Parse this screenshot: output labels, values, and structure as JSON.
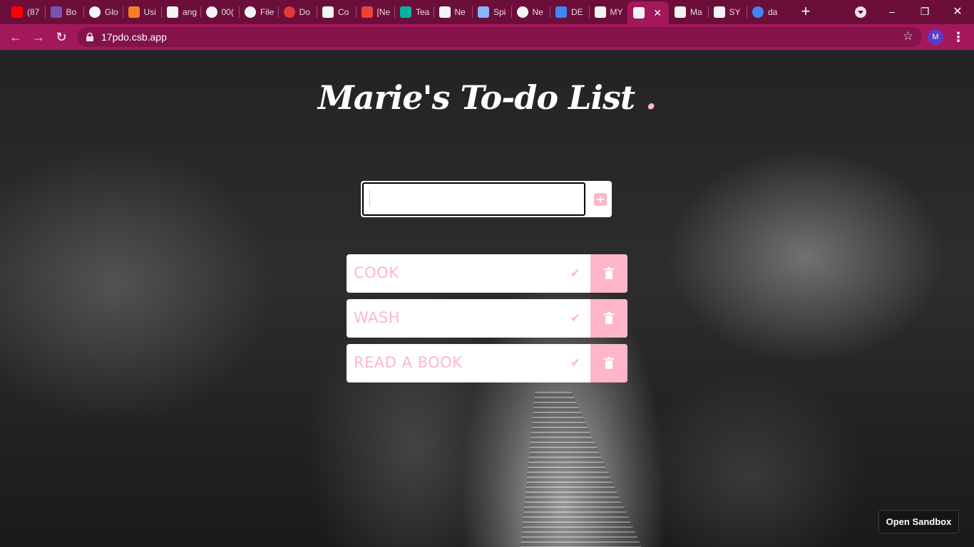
{
  "browser": {
    "tabs": [
      {
        "label": "(87",
        "icon": "youtube-icon",
        "color": "#ff0000"
      },
      {
        "label": "Bo",
        "icon": "bootstrap-icon",
        "color": "#7952b3"
      },
      {
        "label": "Glo",
        "icon": "globe-icon",
        "color": "#ffffff"
      },
      {
        "label": "Usi",
        "icon": "stackoverflow-icon",
        "color": "#f48024"
      },
      {
        "label": "ang",
        "icon": "codesandbox-icon",
        "color": "#ffffff"
      },
      {
        "label": "00(",
        "icon": "globe-icon",
        "color": "#ffffff"
      },
      {
        "label": "File",
        "icon": "globe-icon",
        "color": "#ffffff"
      },
      {
        "label": "Do",
        "icon": "play-icon",
        "color": "#e53935"
      },
      {
        "label": "Co",
        "icon": "codepen-icon",
        "color": "#ffffff"
      },
      {
        "label": "[Ne",
        "icon": "gmail-icon",
        "color": "#ea4335"
      },
      {
        "label": "Tea",
        "icon": "diamond-icon",
        "color": "#00b3a4"
      },
      {
        "label": "Ne",
        "icon": "codepen-icon",
        "color": "#ffffff"
      },
      {
        "label": "Spi",
        "icon": "image-icon",
        "color": "#8ab4f8"
      },
      {
        "label": "Ne",
        "icon": "chrome-icon",
        "color": "#ffffff"
      },
      {
        "label": "DE",
        "icon": "docs-icon",
        "color": "#4285f4"
      },
      {
        "label": "MY",
        "icon": "codesandbox-icon",
        "color": "#ffffff"
      },
      {
        "label": "",
        "icon": "codesandbox-icon",
        "color": "#ffffff",
        "active": true
      },
      {
        "label": "Ma",
        "icon": "codesandbox-icon",
        "color": "#ffffff"
      },
      {
        "label": "SY",
        "icon": "codesandbox-icon",
        "color": "#ffffff"
      },
      {
        "label": "da",
        "icon": "google-icon",
        "color": "#4285f4"
      }
    ],
    "url": "17pdo.csb.app",
    "profile_initial": "M",
    "colors": {
      "tabstrip": "#6b0f3a",
      "toolbar": "#a3185a"
    }
  },
  "app": {
    "title_main": "Marie's To-do List",
    "title_dot": ".",
    "input_value": "",
    "input_placeholder": "",
    "add_icon": "plus-square-icon",
    "todos": [
      {
        "text": "COOK"
      },
      {
        "text": "WASH"
      },
      {
        "text": "READ A BOOK"
      }
    ],
    "accent_color": "#ffb6c8"
  },
  "sandbox_button": "Open Sandbox"
}
